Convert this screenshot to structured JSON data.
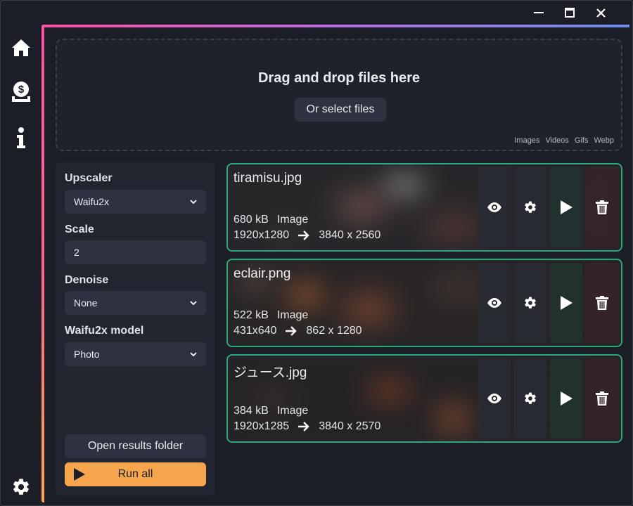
{
  "window": {
    "controls": [
      "minimize-icon",
      "maximize-icon",
      "close-icon"
    ]
  },
  "sidebar": {
    "items": [
      {
        "icon": "home-icon"
      },
      {
        "icon": "donate-icon"
      },
      {
        "icon": "info-icon"
      }
    ],
    "bottom_icon": "gear-icon"
  },
  "dropzone": {
    "title": "Drag and drop files here",
    "select_label": "Or select files",
    "formats": [
      "Images",
      "Videos",
      "Gifs",
      "Webp"
    ]
  },
  "settings": {
    "upscaler_label": "Upscaler",
    "upscaler_value": "Waifu2x",
    "scale_label": "Scale",
    "scale_value": "2",
    "denoise_label": "Denoise",
    "denoise_value": "None",
    "model_label": "Waifu2x model",
    "model_value": "Photo",
    "open_folder_label": "Open results folder",
    "run_all_label": "Run all"
  },
  "files": [
    {
      "name": "tiramisu.jpg",
      "size": "680 kB",
      "type": "Image",
      "input_res": "1920x1280",
      "output_res": "3840 x 2560"
    },
    {
      "name": "eclair.png",
      "size": "522 kB",
      "type": "Image",
      "input_res": "431x640",
      "output_res": "862 x 1280"
    },
    {
      "name": "ジュース.jpg",
      "size": "384 kB",
      "type": "Image",
      "input_res": "1920x1285",
      "output_res": "3840 x 2570"
    }
  ],
  "colors": {
    "accent_run": "#f5a54b",
    "card_border": "#2ea77a",
    "gradient_start": "#ff4fa3",
    "gradient_end": "#6c8cf0"
  }
}
